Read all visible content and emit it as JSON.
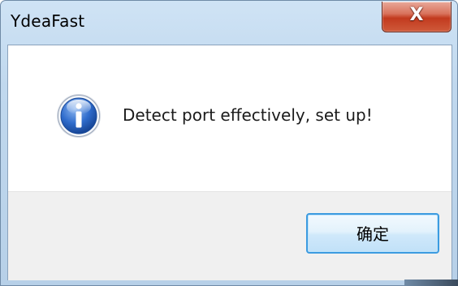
{
  "window": {
    "title": "YdeaFast",
    "close_symbol": "X"
  },
  "dialog": {
    "icon": "information-icon",
    "message": "Detect port effectively, set up!",
    "ok_label": "确定"
  },
  "colors": {
    "titlebar": "#c0d8ee",
    "close_button": "#c23a1e",
    "info_icon": "#2c5fb8",
    "button_area": "#f0f0f0",
    "ok_border": "#3c9be0"
  }
}
